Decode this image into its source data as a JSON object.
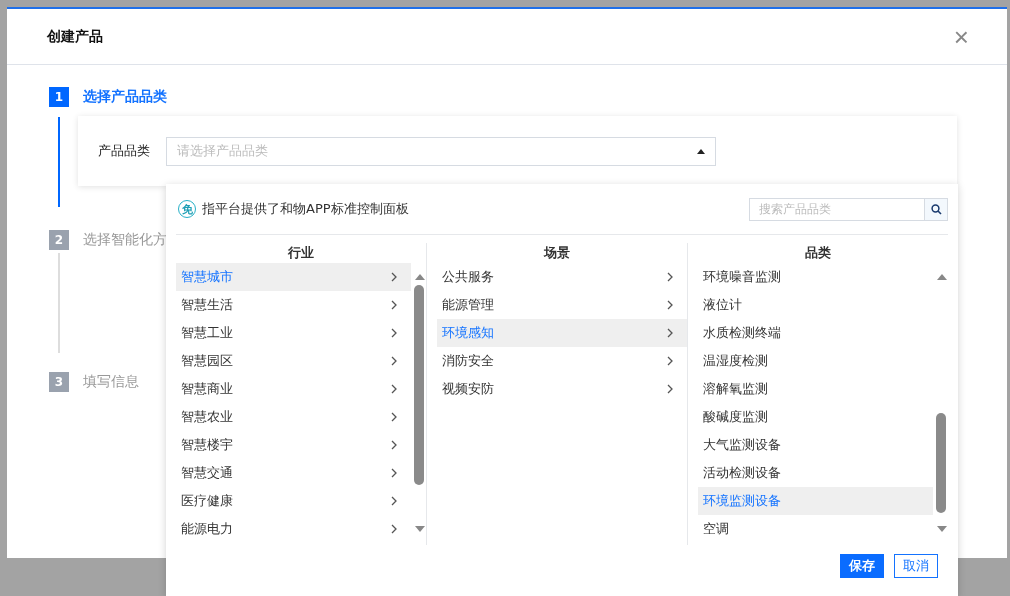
{
  "dialog": {
    "title": "创建产品",
    "close": "×"
  },
  "steps": [
    {
      "number": "1",
      "label": "选择产品品类",
      "active": true
    },
    {
      "number": "2",
      "label": "选择智能化方",
      "active": false
    },
    {
      "number": "3",
      "label": "填写信息",
      "active": false
    }
  ],
  "form": {
    "label": "产品品类",
    "placeholder": "请选择产品品类",
    "expanded": true
  },
  "dropdown": {
    "hint": {
      "badge": "免",
      "text": "指平台提供了和物APP标准控制面板"
    },
    "search": {
      "placeholder": "搜索产品品类"
    },
    "columns": [
      {
        "header": "行业",
        "items": [
          {
            "label": "智慧城市",
            "selected": true,
            "has_children": true
          },
          {
            "label": "智慧生活",
            "selected": false,
            "has_children": true
          },
          {
            "label": "智慧工业",
            "selected": false,
            "has_children": true
          },
          {
            "label": "智慧园区",
            "selected": false,
            "has_children": true
          },
          {
            "label": "智慧商业",
            "selected": false,
            "has_children": true
          },
          {
            "label": "智慧农业",
            "selected": false,
            "has_children": true
          },
          {
            "label": "智慧楼宇",
            "selected": false,
            "has_children": true
          },
          {
            "label": "智慧交通",
            "selected": false,
            "has_children": true
          },
          {
            "label": "医疗健康",
            "selected": false,
            "has_children": true
          },
          {
            "label": "能源电力",
            "selected": false,
            "has_children": true
          }
        ]
      },
      {
        "header": "场景",
        "items": [
          {
            "label": "公共服务",
            "selected": false,
            "has_children": true
          },
          {
            "label": "能源管理",
            "selected": false,
            "has_children": true
          },
          {
            "label": "环境感知",
            "selected": true,
            "has_children": true
          },
          {
            "label": "消防安全",
            "selected": false,
            "has_children": true
          },
          {
            "label": "视频安防",
            "selected": false,
            "has_children": true
          }
        ]
      },
      {
        "header": "品类",
        "items": [
          {
            "label": "环境噪音监测",
            "selected": false,
            "has_children": false
          },
          {
            "label": "液位计",
            "selected": false,
            "has_children": false
          },
          {
            "label": "水质检测终端",
            "selected": false,
            "has_children": false
          },
          {
            "label": "温湿度检测",
            "selected": false,
            "has_children": false
          },
          {
            "label": "溶解氧监测",
            "selected": false,
            "has_children": false
          },
          {
            "label": "酸碱度监测",
            "selected": false,
            "has_children": false
          },
          {
            "label": "大气监测设备",
            "selected": false,
            "has_children": false
          },
          {
            "label": "活动检测设备",
            "selected": false,
            "has_children": false
          },
          {
            "label": "环境监测设备",
            "selected": true,
            "has_children": false
          },
          {
            "label": "空调",
            "selected": false,
            "has_children": false
          }
        ]
      }
    ],
    "buttons": [
      {
        "label": "保存",
        "kind": "primary"
      },
      {
        "label": "取消",
        "kind": "default"
      }
    ]
  }
}
